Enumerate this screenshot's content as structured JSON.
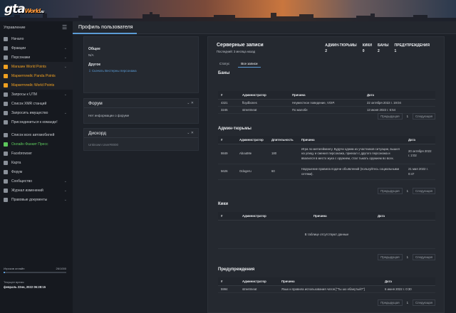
{
  "header": {
    "logo_main": "gta",
    "logo_world": "World",
    "logo_suffix": ".ru",
    "tab_title": "Профиль пользователя"
  },
  "sidebar": {
    "title": "Управление",
    "items": [
      {
        "label": "Начало",
        "icon": "home-icon",
        "chev": false,
        "style": ""
      },
      {
        "label": "Фракции",
        "icon": "flag-icon",
        "chev": true,
        "style": ""
      },
      {
        "label": "Персонажи",
        "icon": "users-icon",
        "chev": true,
        "style": ""
      },
      {
        "label": "Магазин World Points",
        "icon": "cart-icon",
        "chev": true,
        "style": "orange"
      },
      {
        "label": "Маркетплейс Panda Points",
        "icon": "store-icon",
        "chev": false,
        "style": "orange"
      },
      {
        "label": "Маркетплейс World Points",
        "icon": "store-icon",
        "chev": false,
        "style": "orange"
      },
      {
        "label": "Запросы к UTM",
        "icon": "inbox-icon",
        "chev": true,
        "style": ""
      },
      {
        "label": "Список XMR станций",
        "icon": "list-icon",
        "chev": false,
        "style": ""
      },
      {
        "label": "Запросить имущество",
        "icon": "request-icon",
        "chev": true,
        "style": ""
      },
      {
        "label": "Присоединиться к команде!",
        "icon": "join-icon",
        "chev": false,
        "style": ""
      },
      {
        "label": "Список всех автомобилей",
        "icon": "car-icon",
        "chev": false,
        "style": ""
      },
      {
        "label": "Онлайн Фанкит Пресс",
        "icon": "radio-icon",
        "chev": false,
        "style": "green"
      },
      {
        "label": "Facebrowser",
        "icon": "browser-icon",
        "chev": false,
        "style": ""
      },
      {
        "label": "Карта",
        "icon": "map-icon",
        "chev": false,
        "style": ""
      },
      {
        "label": "Форум",
        "icon": "forum-icon",
        "chev": false,
        "style": ""
      },
      {
        "label": "Сообщество",
        "icon": "share-icon",
        "chev": true,
        "style": ""
      },
      {
        "label": "Журнал изменений",
        "icon": "journal-icon",
        "chev": true,
        "style": ""
      },
      {
        "label": "Правовые документы",
        "icon": "document-icon",
        "chev": true,
        "style": ""
      }
    ],
    "online_label": "Игроков онлайн",
    "online_value": "26/1000",
    "online_fraction": 0.026,
    "time_label": "Текущее время",
    "time_value": "февраль 22нн, 2022 06:28:15"
  },
  "left_panels": {
    "general_label": "Общее",
    "general_value": "N/A",
    "other_label": "Другое",
    "other_link": "Скачать Вестерны персонажа",
    "forum_title": "Форум",
    "forum_text": "Нет информации о форуме",
    "discord_title": "Дискорд",
    "discord_text": "Unknown User#0000"
  },
  "records": {
    "title": "Серверные записи",
    "subtitle": "Последний: 3 месяца назад",
    "stats": [
      {
        "label": "АДМИН-ТЮРЬМЫ",
        "value": "2"
      },
      {
        "label": "КИКИ",
        "value": "0"
      },
      {
        "label": "БАНЫ",
        "value": "2"
      },
      {
        "label": "ПРЕДУПРЕЖДЕНИЯ",
        "value": "1"
      }
    ],
    "tabs": [
      "Статус",
      "Все записи"
    ],
    "prev": "Предыдущая",
    "next": "Следующая",
    "page": "1"
  },
  "bans": {
    "title": "Баны",
    "headers": [
      "#",
      "Администратор",
      "Причина",
      "Дата"
    ],
    "rows": [
      [
        "4321",
        "floydbones",
        "Неуместное поведение, VOIP.",
        "22 октября 2022 г. 19:04"
      ],
      [
        "3245",
        "streetmeat",
        "По жалобе",
        "13 июня 2022 г. 6:54"
      ]
    ]
  },
  "jails": {
    "title": "Админ-тюрьмы",
    "headers": [
      "#",
      "Администратор",
      "Длительность",
      "Причина",
      "Дата"
    ],
    "rows": [
      [
        "9849",
        "AboutMe",
        "180",
        "Игра по метагеймингу. Будучи одним из участников ситуации, вышел на улицу и сменил персонажа, приехал с другого персонажа и ввалился в место жука с оружием, стал тыкать оружием во всех.",
        "20 октября 2022 г. 2:02"
      ],
      [
        "5626",
        "Odogeru",
        "60",
        "Нарушение правила подачи объявлений (пользуйтесь социальными сетями).",
        "21 мая 2022 г. 0:47"
      ]
    ]
  },
  "kicks": {
    "title": "Кики",
    "headers": [
      "#",
      "Администратор",
      "Причина",
      "Дата"
    ],
    "empty": "В таблице отсутствуют данные"
  },
  "warnings": {
    "title": "Предупреждения",
    "headers": [
      "#",
      "Администратор",
      "Причина",
      "Дата"
    ],
    "rows": [
      [
        "5994",
        "streetmeat",
        "Язык и правила использования чатов [\"Ты шо ебанутый?\"]",
        "6 июня 2022 г. 0:30"
      ]
    ]
  },
  "colors": {
    "accent": "#5b9bd5",
    "orange": "#f0a020",
    "green": "#5cc85c"
  }
}
